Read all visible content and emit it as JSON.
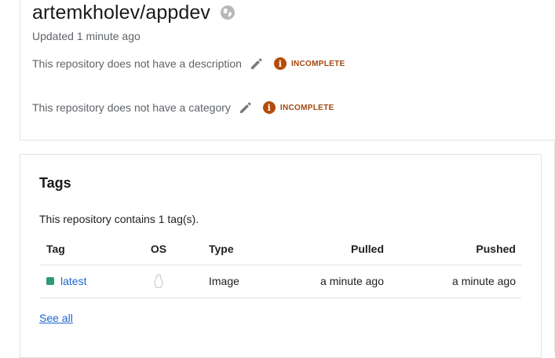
{
  "repo": {
    "title": "artemkholev/appdev",
    "visibility_icon": "globe-icon",
    "updated": "Updated 1 minute ago",
    "description_text": "This repository does not have a description",
    "category_text": "This repository does not have a category",
    "description_status": "INCOMPLETE",
    "category_status": "INCOMPLETE",
    "status_color": "#b34c0b"
  },
  "tags": {
    "title": "Tags",
    "summary": "This repository contains 1 tag(s).",
    "columns": {
      "tag": "Tag",
      "os": "OS",
      "type": "Type",
      "pulled": "Pulled",
      "pushed": "Pushed"
    },
    "rows": [
      {
        "tag": "latest",
        "os_icon": "linux-icon",
        "type": "Image",
        "pulled": "a minute ago",
        "pushed": "a minute ago"
      }
    ],
    "see_all": "See all"
  },
  "colors": {
    "link": "#1a66d2",
    "tag_status": "#2c9a76"
  }
}
